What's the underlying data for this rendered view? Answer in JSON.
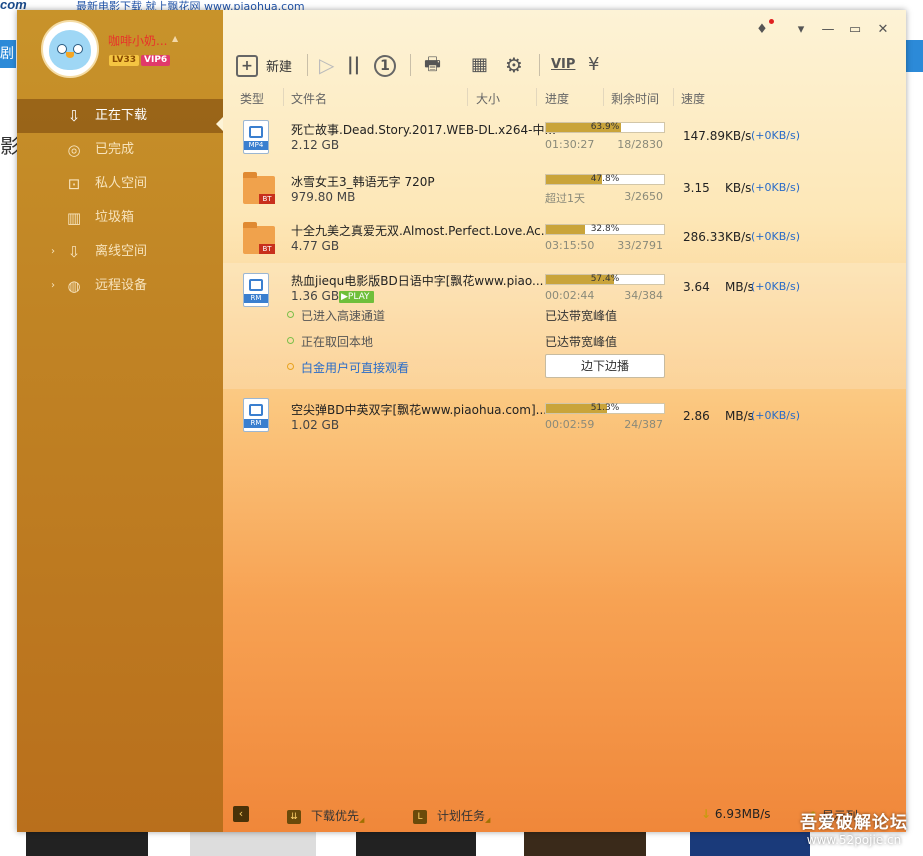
{
  "background": {
    "corner_text": "com",
    "url_text": "最新电影下载 就上飘花网 www.piaohua.com",
    "tab_fragment": "剧",
    "side_char": "影"
  },
  "watermark": {
    "line1": "吾爱破解论坛",
    "line2": "www.52pojie.cn"
  },
  "user": {
    "name": "咖啡小奶...",
    "level": "LV33",
    "vip": "VIP6"
  },
  "sidebar": {
    "items": [
      {
        "label": "正在下载",
        "icon": "download-icon",
        "active": true
      },
      {
        "label": "已完成",
        "icon": "check-circle-icon"
      },
      {
        "label": "私人空间",
        "icon": "lock-icon"
      },
      {
        "label": "垃圾箱",
        "icon": "trash-icon"
      },
      {
        "label": "离线空间",
        "icon": "offline-download-icon"
      },
      {
        "label": "远程设备",
        "icon": "remote-device-icon"
      }
    ]
  },
  "toolbar": {
    "new_label": "新建",
    "icons": [
      "new-task-icon",
      "play-icon",
      "pause-icon",
      "limit-speed-icon",
      "shutdown-icon",
      "apps-icon",
      "settings-icon",
      "vip-icon",
      "wallet-icon"
    ],
    "vip_text": "VIP"
  },
  "columns": {
    "type": "类型",
    "filename": "文件名",
    "size": "大小",
    "progress": "进度",
    "remaining": "剩余时间",
    "speed": "速度"
  },
  "tasks": [
    {
      "type": "MP4",
      "name": "死亡故事.Dead.Story.2017.WEB-DL.x264-中...",
      "size": "2.12 GB",
      "progress": 63.9,
      "progress_text": "63.9%",
      "time": "01:30:27",
      "count": "18/2830",
      "speed": "147.89KB/s",
      "speed_up": "(+0KB/s)"
    },
    {
      "type": "BT",
      "name": "冰雪女王3_韩语无字 720P",
      "size": "979.80 MB",
      "progress": 47.8,
      "progress_text": "47.8%",
      "time": "超过1天",
      "count": "3/2650",
      "speed": "3.15    KB/s",
      "speed_up": "(+0KB/s)"
    },
    {
      "type": "BT",
      "name": "十全九美之真爱无双.Almost.Perfect.Love.Ac...",
      "size": "4.77 GB",
      "progress": 32.8,
      "progress_text": "32.8%",
      "time": "03:15:50",
      "count": "33/2791",
      "speed": "286.33KB/s",
      "speed_up": "(+0KB/s)"
    },
    {
      "type": "RM",
      "name": "热血jiequ电影版BD日语中字[飘花www.piao...",
      "size": "1.36 GB",
      "progress": 57.4,
      "progress_text": "57.4%",
      "time": "00:02:44",
      "count": "34/384",
      "speed": "3.64    MB/s",
      "speed_up": "(+0KB/s)",
      "play": "PLAY",
      "details": {
        "line1": "已进入高速通道",
        "line1_right": "已达带宽峰值",
        "line2": "正在取回本地",
        "line2_right": "已达带宽峰值",
        "line3": "白金用户可直接观看",
        "stream_button": "边下边播"
      }
    },
    {
      "type": "RM",
      "name": "空尖弹BD中英双字[飘花www.piaohua.com]....",
      "size": "1.02 GB",
      "progress": 51.3,
      "progress_text": "51.3%",
      "time": "00:02:59",
      "count": "24/387",
      "speed": "2.86    MB/s",
      "speed_up": "(+0KB/s)"
    }
  ],
  "statusbar": {
    "priority": "下载优先",
    "schedule": "计划任务",
    "speed": "6.93MB/s",
    "right_text": "显示列..."
  },
  "colors": {
    "accent": "#c9a43a",
    "link": "#2a6cc8",
    "sidebar": "#c08324",
    "active_user": "#e8322b"
  }
}
